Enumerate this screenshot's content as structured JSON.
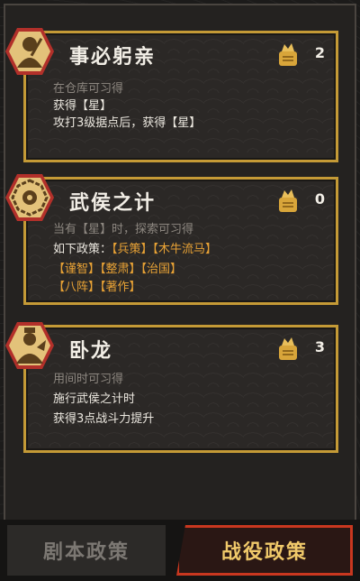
{
  "cards": [
    {
      "title": "事必躬亲",
      "count": "2",
      "icon": "scholar-portrait-icon",
      "lines": [
        {
          "text": "在仓库可习得",
          "dim": true
        },
        {
          "text": "获得【星】",
          "dim": false
        },
        {
          "text": "攻打3级据点后，获得【星】",
          "dim": false
        }
      ]
    },
    {
      "title": "武侯之计",
      "count": "0",
      "icon": "bagua-icon",
      "line1": "当有【星】时，探索可习得",
      "line2_prefix": "如下政策：",
      "tags_row1": [
        "【兵策】",
        "【木牛流马】"
      ],
      "tags_row2": [
        "【谨智】",
        "【整肃】",
        "【治国】"
      ],
      "tags_row3": [
        "【八阵】",
        "【著作】"
      ]
    },
    {
      "title": "卧龙",
      "count": "3",
      "icon": "zhuge-portrait-icon",
      "lines": [
        {
          "text": "用间时可习得",
          "dim": true
        },
        {
          "text": "施行武侯之计时",
          "dim": false
        },
        {
          "text": "获得3点战斗力提升",
          "dim": false
        }
      ]
    }
  ],
  "tabs": {
    "script_policy": "剧本政策",
    "battle_policy": "战役政策"
  },
  "colors": {
    "gold_border": "#c49a36",
    "tag_orange": "#e8a235",
    "active_tab_border": "#c8371f",
    "badge_red": "#b2302a"
  }
}
